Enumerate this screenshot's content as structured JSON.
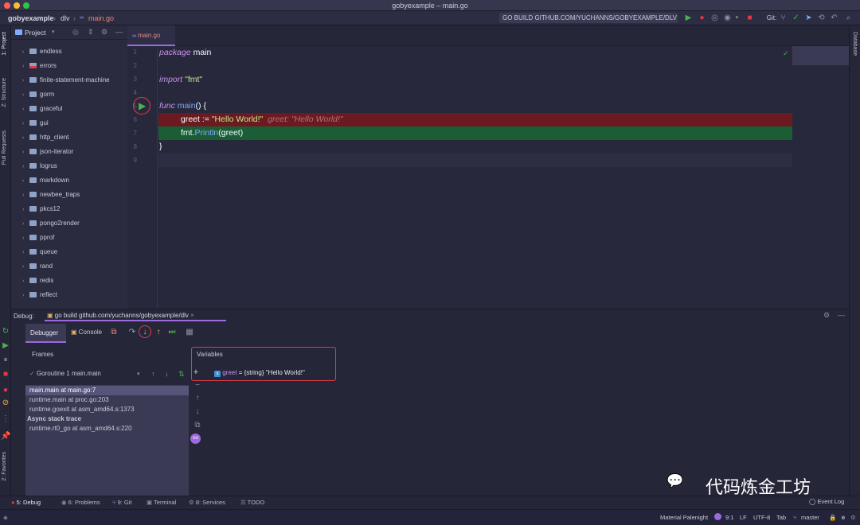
{
  "window": {
    "title": "gobyexample – main.go"
  },
  "navbar": {
    "crumb1": "gobyexample",
    "crumb2": "dlv",
    "crumb3": "main.go"
  },
  "run_config": "GO BUILD GITHUB.COM/YUCHANNS/GOBYEXAMPLE/DLV",
  "git_label": "Git:",
  "left_strip": {
    "project": "1: Project",
    "structure": "Z: Structure",
    "pull": "Pull Requests",
    "favorites": "2: Favorites"
  },
  "right_strip": {
    "database": "Database"
  },
  "project_panel": {
    "title": "Project",
    "items": [
      "endless",
      "errors",
      "finite-statement-machine",
      "gorm",
      "graceful",
      "gui",
      "http_client",
      "json-iterator",
      "logrus",
      "markdown",
      "newbee_traps",
      "pkcs12",
      "pongo2render",
      "pprof",
      "queue",
      "rand",
      "redis",
      "reflect"
    ]
  },
  "editor": {
    "tab_label": "main.go",
    "line_numbers": [
      "1",
      "2",
      "3",
      "4",
      "5",
      "6",
      "7",
      "8",
      "9"
    ],
    "code": {
      "l1_kw": "package",
      "l1_rest": " main",
      "l3_kw": "import",
      "l3_str": " \"fmt\"",
      "l5_kw": "func",
      "l5_fn": " main",
      "l5_rest": "() {",
      "l6_var": "greet := ",
      "l6_str": "\"Hello World!\"",
      "l6_hint": "  greet: \"Hello World!\"",
      "l7_pkg": "fmt.",
      "l7_fn": "Println",
      "l7_rest": "(greet)",
      "l8": "}"
    }
  },
  "debug": {
    "label": "Debug:",
    "session_tab": "go build github.com/yuchanns/gobyexample/dlv",
    "tab_debugger": "Debugger",
    "tab_console": "Console",
    "frames_title": "Frames",
    "goroutine": "Goroutine 1 main.main",
    "frames": [
      "main.main at main.go:7",
      "runtime.main at proc.go:203",
      "runtime.goexit at asm_amd64.s:1373"
    ],
    "async_label": "Async stack trace",
    "async_frames": [
      "runtime.rt0_go at asm_amd64.s:220"
    ],
    "variables_title": "Variables",
    "variable_name": "greet",
    "variable_value": " = {string} \"Hello World!\""
  },
  "bottom_tabs": [
    "5: Debug",
    "6: Problems",
    "9: Git",
    "Terminal",
    "8: Services",
    "TODO"
  ],
  "status": {
    "theme": "Material Palenight",
    "position": "9:1",
    "line_sep": "LF",
    "encoding": "UTF-8",
    "indent": "Tab",
    "branch": "master",
    "event_log": "Event Log"
  },
  "watermark": "代码炼金工坊",
  "colors": {
    "accent": "#9c6ade",
    "bp_line": "#6b1b1f",
    "exec_line": "#1b5d35",
    "highlight": "#e53945"
  }
}
